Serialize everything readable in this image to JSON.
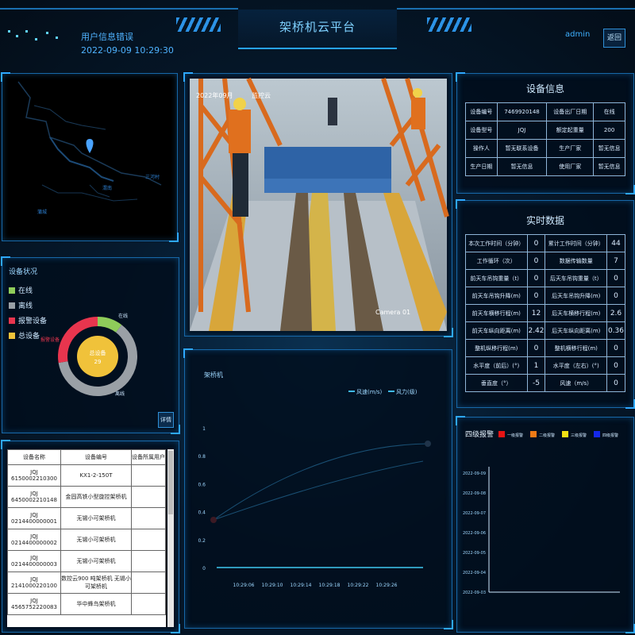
{
  "header": {
    "title": "架桥机云平台",
    "user_label": "用户信息错误",
    "datetime": "2022-09-09 10:29:30",
    "admin": "admin",
    "back": "返回"
  },
  "map": {
    "labels": [
      "渭南",
      "三河村",
      "蒲城"
    ]
  },
  "video": {
    "overlay_time": "2022年09月",
    "overlay_title": "监控云",
    "camera_label": "Camera 01"
  },
  "device_info": {
    "title": "设备信息",
    "rows": [
      [
        "设备编号",
        "7469920148",
        "设备出厂日期",
        "在线"
      ],
      [
        "设备型号",
        "JQJ",
        "额定起重量",
        "200"
      ],
      [
        "操作人",
        "暂无联系设备",
        "生产厂家",
        "暂无信息"
      ],
      [
        "生产日期",
        "暂无信息",
        "使用厂家",
        "暂无信息"
      ]
    ]
  },
  "realtime": {
    "title": "实时数据",
    "rows": [
      [
        "本次工作时间（分钟）",
        "0",
        "累计工作时间（分钟）",
        "44"
      ],
      [
        "工作循环（次）",
        "0",
        "数据传输数量",
        "7"
      ],
      [
        "前天车吊钩重量（t）",
        "0",
        "后天车吊钩重量（t）",
        "0"
      ],
      [
        "前天车吊钩升降(m)",
        "0",
        "后天车吊钩升降(m)",
        "0"
      ],
      [
        "前天车横移行程(m)",
        "12",
        "后天车横移行程(m)",
        "2.6"
      ],
      [
        "前天车纵向距离(m)",
        "2.42",
        "后天车纵向距离(m)",
        "0.36"
      ],
      [
        "整机纵移行程(m)",
        "0",
        "整机横移行程(m)",
        "0"
      ],
      [
        "水平度（前后）(°)",
        "1",
        "水平度（左右）(°)",
        "0"
      ],
      [
        "垂直度（°）",
        "-5",
        "风速（m/s）",
        "0"
      ]
    ]
  },
  "status": {
    "title": "设备状况",
    "legend": [
      {
        "label": "在线",
        "color": "#8fcc5a"
      },
      {
        "label": "离线",
        "color": "#9aa0a6"
      },
      {
        "label": "报警设备",
        "color": "#e8354e"
      },
      {
        "label": "总设备",
        "color": "#f0c23a"
      }
    ],
    "center_label": "总设备",
    "center_value": "29",
    "ring_labels": {
      "online": "在线",
      "offline": "离线",
      "alarm": "报警设备"
    },
    "online": 3,
    "offline": 18,
    "alarm": 8,
    "details": "详情"
  },
  "list": {
    "headers": [
      "设备名称",
      "设备编号",
      "设备所属用户"
    ],
    "rows": [
      [
        "JQJ 6150002210300",
        "KX1-2-150T",
        ""
      ],
      [
        "JQJ 6450002210148",
        "金固高铁小型旋控架桥机",
        ""
      ],
      [
        "JQJ 0214400000001",
        "无锡小可架桥机",
        ""
      ],
      [
        "JQJ 0214400000002",
        "无锡小可架桥机",
        ""
      ],
      [
        "JQJ 0214400000003",
        "无锡小可架桥机",
        ""
      ],
      [
        "JQJ 2141000220100",
        "数控云900 吨架桥机 无锡小可架桥机",
        ""
      ],
      [
        "JQJ 4565752220083",
        "华中蜂鸟架桥机",
        ""
      ]
    ]
  },
  "chart_data": [
    {
      "type": "line",
      "title": "架桥机",
      "series": [
        {
          "name": "风速(m/s)",
          "color": "#3fb8e6",
          "values": []
        },
        {
          "name": "风力(级)",
          "color": "#3fb8e6",
          "values": []
        }
      ],
      "x_ticks": [
        "10:29:06",
        "10:29:10",
        "10:29:14",
        "10:29:18",
        "10:29:22",
        "10:29:26"
      ],
      "y_ticks": [
        "0",
        "0.2",
        "0.4",
        "0.6",
        "0.8",
        "1"
      ],
      "ylim": [
        0,
        1
      ]
    },
    {
      "type": "scatter",
      "title": "四级报警",
      "series": [
        {
          "name": "一级报警",
          "color": "#e81414",
          "values": []
        },
        {
          "name": "二级报警",
          "color": "#f07a16",
          "values": []
        },
        {
          "name": "三级报警",
          "color": "#f5e014",
          "values": []
        },
        {
          "name": "四级报警",
          "color": "#1428e8",
          "values": []
        }
      ],
      "y_ticks": [
        "2022-09-09",
        "2022-09-08",
        "2022-09-07",
        "2022-09-06",
        "2022-09-05",
        "2022-09-04",
        "2022-09-03"
      ]
    }
  ]
}
